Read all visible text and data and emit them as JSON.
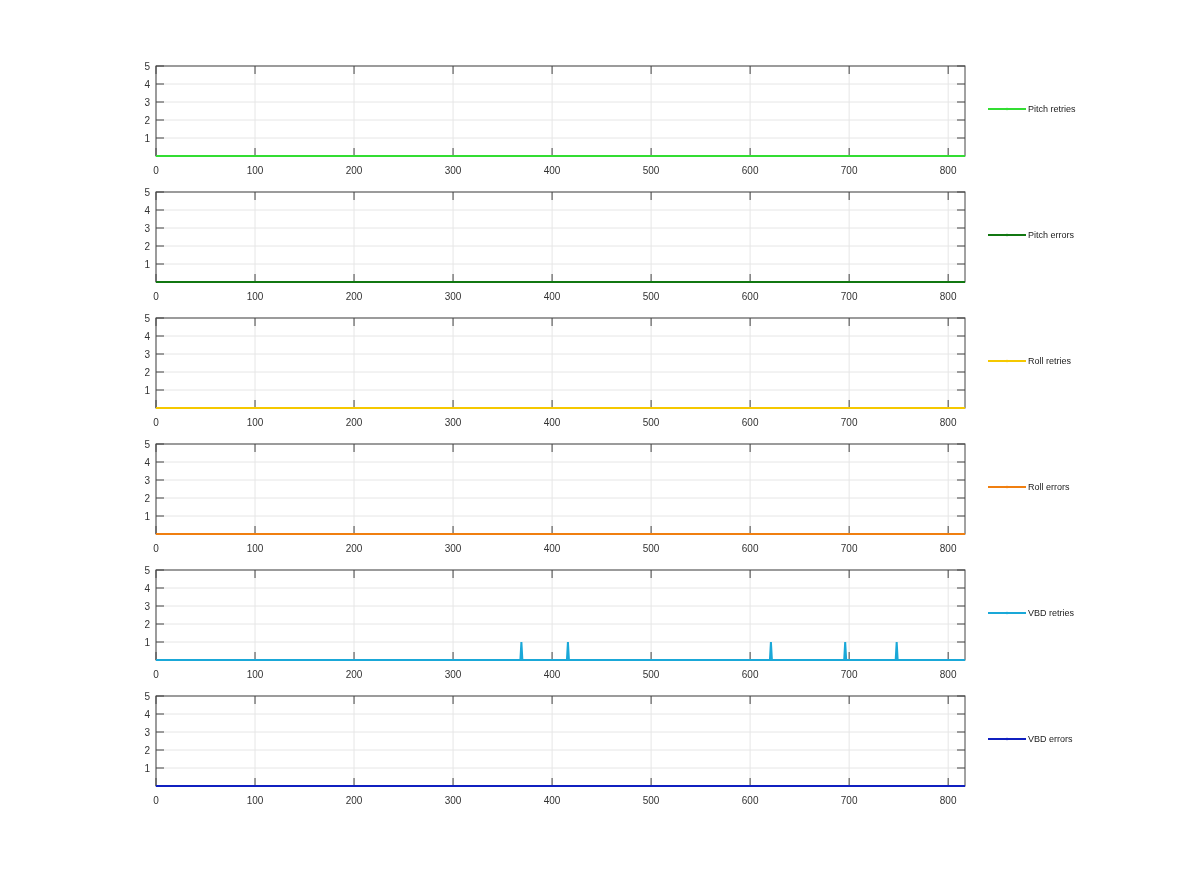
{
  "charts": [
    {
      "chart_data": {
        "type": "line",
        "x": [
          0,
          817
        ],
        "series": [
          {
            "name": "Pitch retries",
            "color": "#33dd33",
            "values": [
              0,
              0
            ]
          }
        ],
        "xlim": [
          0,
          817
        ],
        "ylim": [
          0,
          5
        ],
        "xticks": [
          0,
          100,
          200,
          300,
          400,
          500,
          600,
          700,
          800
        ],
        "yticks": [
          1,
          2,
          3,
          4,
          5
        ],
        "grid": true
      }
    },
    {
      "chart_data": {
        "type": "line",
        "x": [
          0,
          817
        ],
        "series": [
          {
            "name": "Pitch errors",
            "color": "#117711",
            "values": [
              0,
              0
            ]
          }
        ],
        "xlim": [
          0,
          817
        ],
        "ylim": [
          0,
          5
        ],
        "xticks": [
          0,
          100,
          200,
          300,
          400,
          500,
          600,
          700,
          800
        ],
        "yticks": [
          1,
          2,
          3,
          4,
          5
        ],
        "grid": true
      }
    },
    {
      "chart_data": {
        "type": "line",
        "x": [
          0,
          817
        ],
        "series": [
          {
            "name": "Roll retries",
            "color": "#f5c800",
            "values": [
              0,
              0
            ]
          }
        ],
        "xlim": [
          0,
          817
        ],
        "ylim": [
          0,
          5
        ],
        "xticks": [
          0,
          100,
          200,
          300,
          400,
          500,
          600,
          700,
          800
        ],
        "yticks": [
          1,
          2,
          3,
          4,
          5
        ],
        "grid": true
      }
    },
    {
      "chart_data": {
        "type": "line",
        "x": [
          0,
          817
        ],
        "series": [
          {
            "name": "Roll errors",
            "color": "#f07f10",
            "values": [
              0,
              0
            ]
          }
        ],
        "xlim": [
          0,
          817
        ],
        "ylim": [
          0,
          5
        ],
        "xticks": [
          0,
          100,
          200,
          300,
          400,
          500,
          600,
          700,
          800
        ],
        "yticks": [
          1,
          2,
          3,
          4,
          5
        ],
        "grid": true
      }
    },
    {
      "chart_data": {
        "type": "line",
        "x": [
          0,
          368,
          369,
          370,
          415,
          416,
          417,
          620,
          621,
          622,
          695,
          696,
          697,
          747,
          748,
          749,
          817
        ],
        "series": [
          {
            "name": "VBD retries",
            "color": "#1aa8d8",
            "values": [
              0,
              0,
              1,
              0,
              0,
              1,
              0,
              0,
              1,
              0,
              0,
              1,
              0,
              0,
              1,
              0,
              0
            ]
          }
        ],
        "xlim": [
          0,
          817
        ],
        "ylim": [
          0,
          5
        ],
        "xticks": [
          0,
          100,
          200,
          300,
          400,
          500,
          600,
          700,
          800
        ],
        "yticks": [
          1,
          2,
          3,
          4,
          5
        ],
        "grid": true
      }
    },
    {
      "chart_data": {
        "type": "line",
        "x": [
          0,
          817
        ],
        "series": [
          {
            "name": "VBD errors",
            "color": "#1020c0",
            "values": [
              0,
              0
            ]
          }
        ],
        "xlim": [
          0,
          817
        ],
        "ylim": [
          0,
          5
        ],
        "xticks": [
          0,
          100,
          200,
          300,
          400,
          500,
          600,
          700,
          800
        ],
        "yticks": [
          1,
          2,
          3,
          4,
          5
        ],
        "grid": true
      }
    }
  ]
}
